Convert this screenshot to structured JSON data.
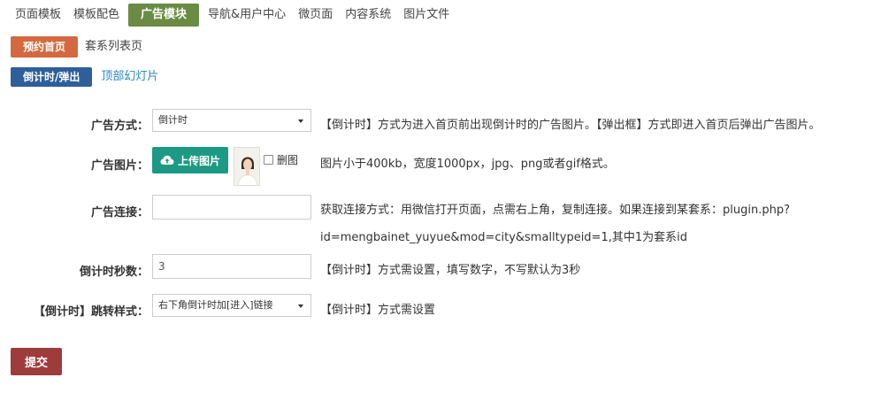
{
  "topnav": {
    "items": [
      "页面模板",
      "模板配色",
      "广告模块",
      "导航&用户中心",
      "微页面",
      "内容系统",
      "图片文件"
    ],
    "active_index": 2
  },
  "subnav1": {
    "active": "预约首页",
    "other": "套系列表页"
  },
  "subnav2": {
    "active": "倒计时/弹出",
    "other": "顶部幻灯片"
  },
  "form": {
    "ad_mode": {
      "label": "广告方式：",
      "value": "倒计时",
      "hint": "【倒计时】方式为进入首页前出现倒计时的广告图片。【弹出框】方式即进入首页后弹出广告图片。"
    },
    "ad_image": {
      "label": "广告图片：",
      "upload_label": "上传图片",
      "delete_label": "删图",
      "hint": "图片小于400kb，宽度1000px，jpg、png或者gif格式。"
    },
    "ad_link": {
      "label": "广告连接：",
      "value": "",
      "hint_line1": "获取连接方式：用微信打开页面，点需右上角，复制连接。如果连接到某套系：plugin.php?",
      "hint_line2": "id=mengbainet_yuyue&mod=city&smalltypeid=1,其中1为套系id"
    },
    "countdown_seconds": {
      "label": "倒计时秒数：",
      "value": "3",
      "hint": "【倒计时】方式需设置，填写数字，不写默认为3秒"
    },
    "jump_style": {
      "label": "【倒计时】跳转样式：",
      "value": "右下角倒计时加[进入]链接",
      "hint": "【倒计时】方式需设置"
    }
  },
  "submit_label": "提交",
  "colors": {
    "tab_active": "#6b8b45",
    "subnav1_active": "#d4693f",
    "subnav2_active": "#2f5f9a",
    "upload_button": "#1c9a84",
    "submit_button": "#9e3b3b",
    "link": "#2a86c9"
  }
}
